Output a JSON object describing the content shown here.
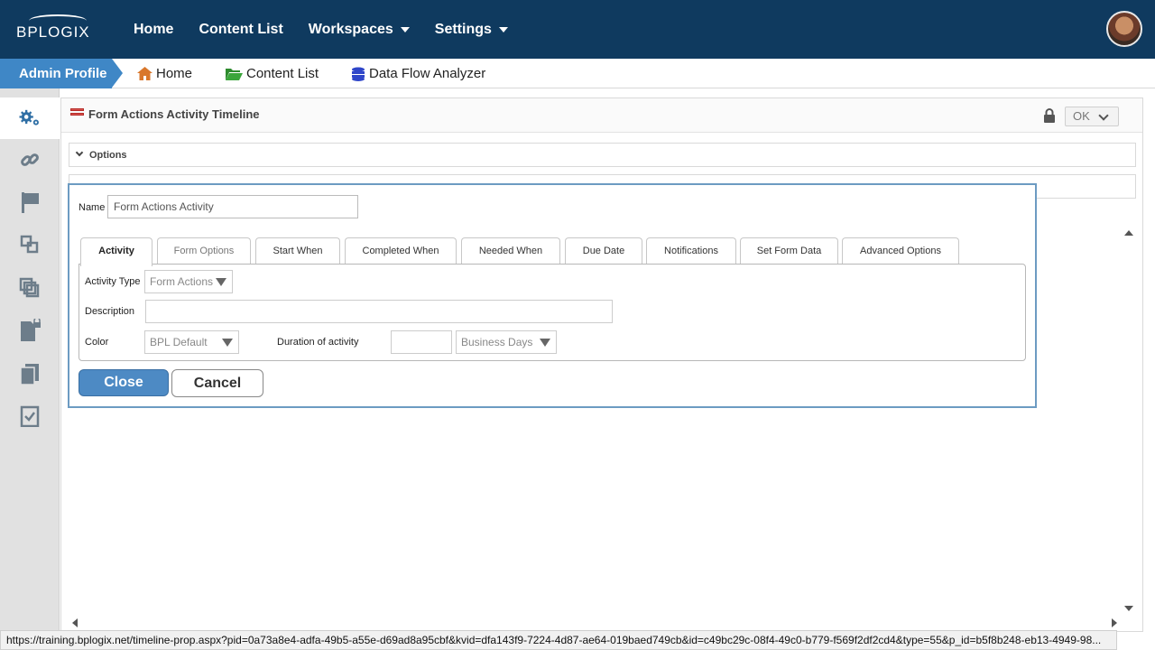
{
  "header": {
    "logo_text": "BPLOGIX",
    "nav": [
      {
        "label": "Home",
        "has_menu": false
      },
      {
        "label": "Content List",
        "has_menu": false
      },
      {
        "label": "Workspaces",
        "has_menu": true
      },
      {
        "label": "Settings",
        "has_menu": true
      }
    ]
  },
  "breadcrumb": {
    "profile": "Admin Profile",
    "items": [
      {
        "label": "Home",
        "icon": "home-icon",
        "color": "#d9772b"
      },
      {
        "label": "Content List",
        "icon": "folder-open-icon",
        "color": "#2e8b2e"
      },
      {
        "label": "Data Flow Analyzer",
        "icon": "database-icon",
        "color": "#2f46c9"
      }
    ]
  },
  "sidebar": {
    "icons": [
      "gears-icon",
      "link-icon",
      "flag-icon",
      "shapes-icon",
      "layers-icon",
      "locked-file-icon",
      "copy-icon",
      "checklist-icon"
    ]
  },
  "panel": {
    "title": "Form Actions Activity Timeline",
    "ok_label": "OK",
    "options_label": "Options"
  },
  "dialog": {
    "name_label": "Name",
    "name_value": "Form Actions Activity",
    "tabs": [
      {
        "label": "Activity",
        "active": true
      },
      {
        "label": "Form Options",
        "active": false
      },
      {
        "label": "Start When",
        "active": false
      },
      {
        "label": "Completed When",
        "active": false
      },
      {
        "label": "Needed When",
        "active": false
      },
      {
        "label": "Due Date",
        "active": false
      },
      {
        "label": "Notifications",
        "active": false
      },
      {
        "label": "Set Form Data",
        "active": false
      },
      {
        "label": "Advanced Options",
        "active": false
      }
    ],
    "fields": {
      "activity_type_label": "Activity Type",
      "activity_type_value": "Form Actions",
      "description_label": "Description",
      "description_value": "",
      "color_label": "Color",
      "color_value": "BPL Default",
      "duration_label": "Duration of activity",
      "duration_value": "",
      "duration_unit": "Business Days"
    },
    "close_label": "Close",
    "cancel_label": "Cancel"
  },
  "status": {
    "url": "https://training.bplogix.net/timeline-prop.aspx?pid=0a73a8e4-adfa-49b5-a55e-d69ad8a95cbf&kvid=dfa143f9-7224-4d87-ae64-019baed749cb&id=c49bc29c-08f4-49c0-b779-f569f2df2cd4&type=55&p_id=b5f8b248-eb13-4949-98..."
  },
  "colors": {
    "topbar": "#0f3a5f",
    "accent": "#3f87c6",
    "close_button": "#4d8ac4",
    "dialog_border": "#6c9bc2"
  }
}
